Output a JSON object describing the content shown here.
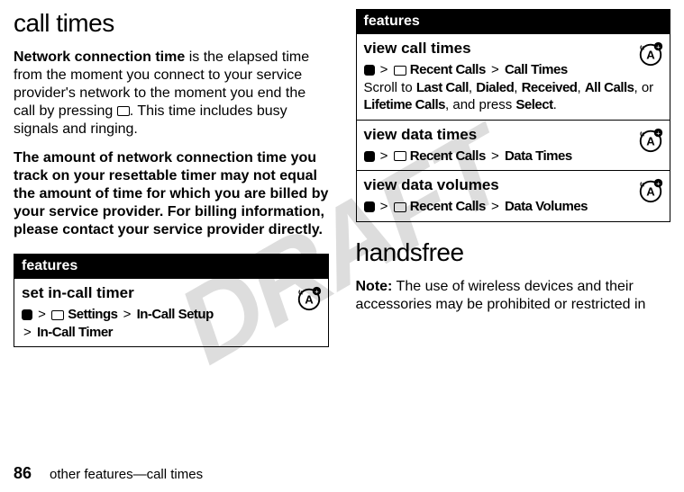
{
  "watermark": "DRAFT",
  "left": {
    "heading": "call times",
    "para1_prefix": "Network connection time",
    "para1_rest": " is the elapsed time from the moment you connect to your service provider's network to the moment you end the call by pressing ",
    "para1_after_icon": ". This time includes busy signals and ringing.",
    "para2": "The amount of network connection time you track on your resettable timer may not equal the amount of time for which you are billed by your service provider. For billing information, please contact your service provider directly.",
    "features_header": "features",
    "row1": {
      "title": "set in-call timer",
      "settings_label": "Settings",
      "incall_setup": "In-Call Setup",
      "incall_timer": "In-Call Timer"
    }
  },
  "right": {
    "features_header": "features",
    "row1": {
      "title": "view call times",
      "recent_label": "Recent Calls",
      "call_times": "Call Times",
      "desc_pre": "Scroll to ",
      "lc": "Last Call",
      "dialed": "Dialed",
      "received": "Received",
      "allcalls": "All Calls",
      "or": ", or ",
      "lifetime": "Lifetime Calls",
      "press": ", and press ",
      "select": "Select",
      "period": "."
    },
    "row2": {
      "title": "view data times",
      "recent_label": "Recent Calls",
      "data_times": "Data Times"
    },
    "row3": {
      "title": "view data volumes",
      "recent_label": "Recent Calls",
      "data_volumes": "Data Volumes"
    },
    "heading": "handsfree",
    "note_label": "Note:",
    "note_text": " The use of wireless devices and their accessories may be prohibited or restricted in"
  },
  "footer": {
    "pageno": "86",
    "text": "other features—call times"
  }
}
